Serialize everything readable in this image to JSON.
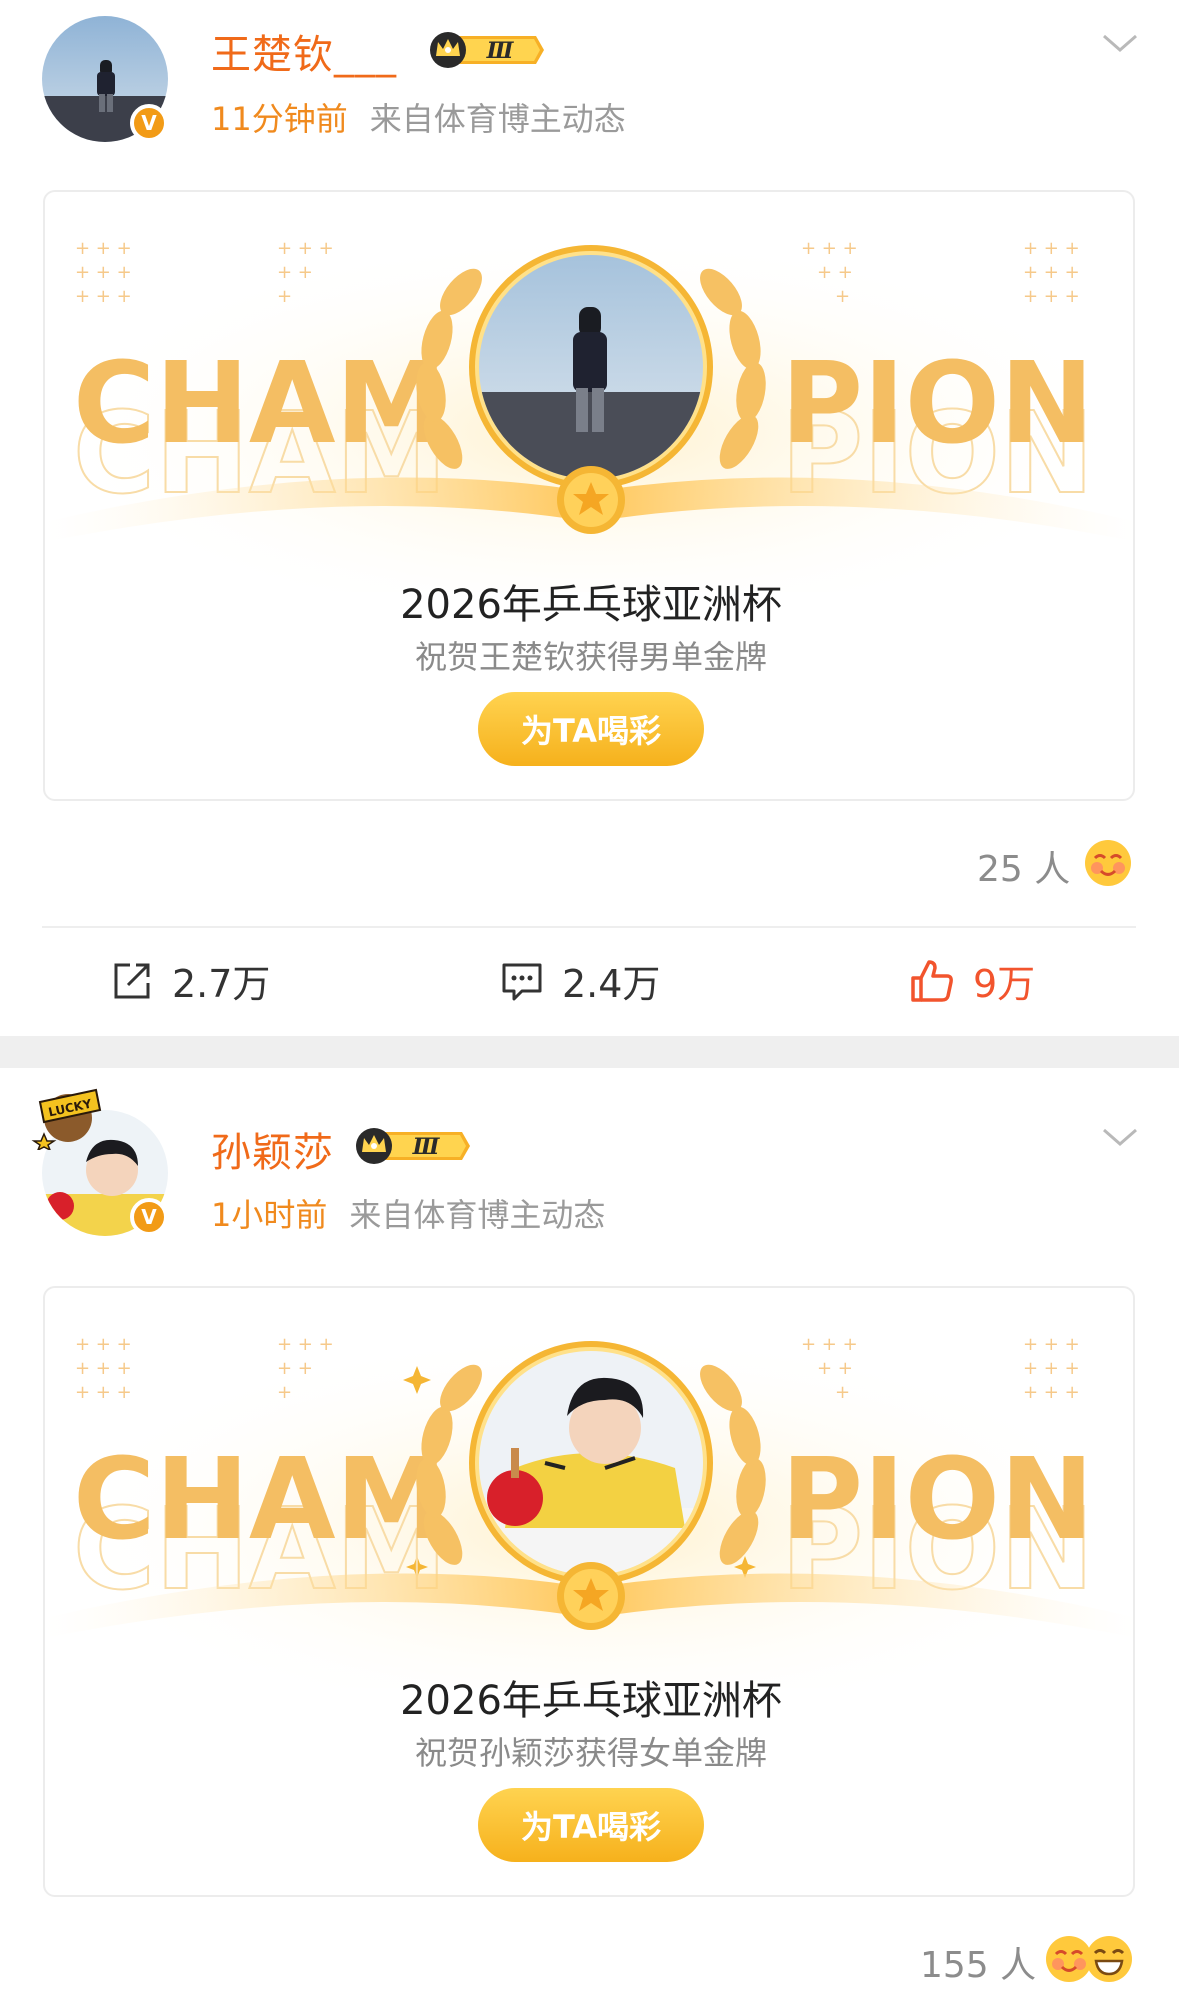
{
  "posts": [
    {
      "author": "王楚钦___",
      "time": "11分钟前",
      "source": "来自体育博主动态",
      "rank": "Ⅲ",
      "card": {
        "word_left": "CHAM",
        "word_right": "PION",
        "title": "2026年乒乓球亚洲杯",
        "subtitle": "祝贺王楚钦获得男单金牌",
        "button": "为TA喝彩"
      },
      "reactions": "25 人",
      "reposts": "2.7万",
      "comments": "2.4万",
      "likes": "9万"
    },
    {
      "author": "孙颖莎",
      "time": "1小时前",
      "source": "来自体育博主动态",
      "rank": "Ⅲ",
      "avatar_frame": "LUCKY",
      "card": {
        "word_left": "CHAM",
        "word_right": "PION",
        "title": "2026年乒乓球亚洲杯",
        "subtitle": "祝贺孙颖莎获得女单金牌",
        "button": "为TA喝彩"
      },
      "reactions": "155 人"
    }
  ],
  "colors": {
    "username": "#f06a19",
    "accent": "#f6b11c",
    "like": "#f2542d",
    "verified": "#f29b16"
  }
}
